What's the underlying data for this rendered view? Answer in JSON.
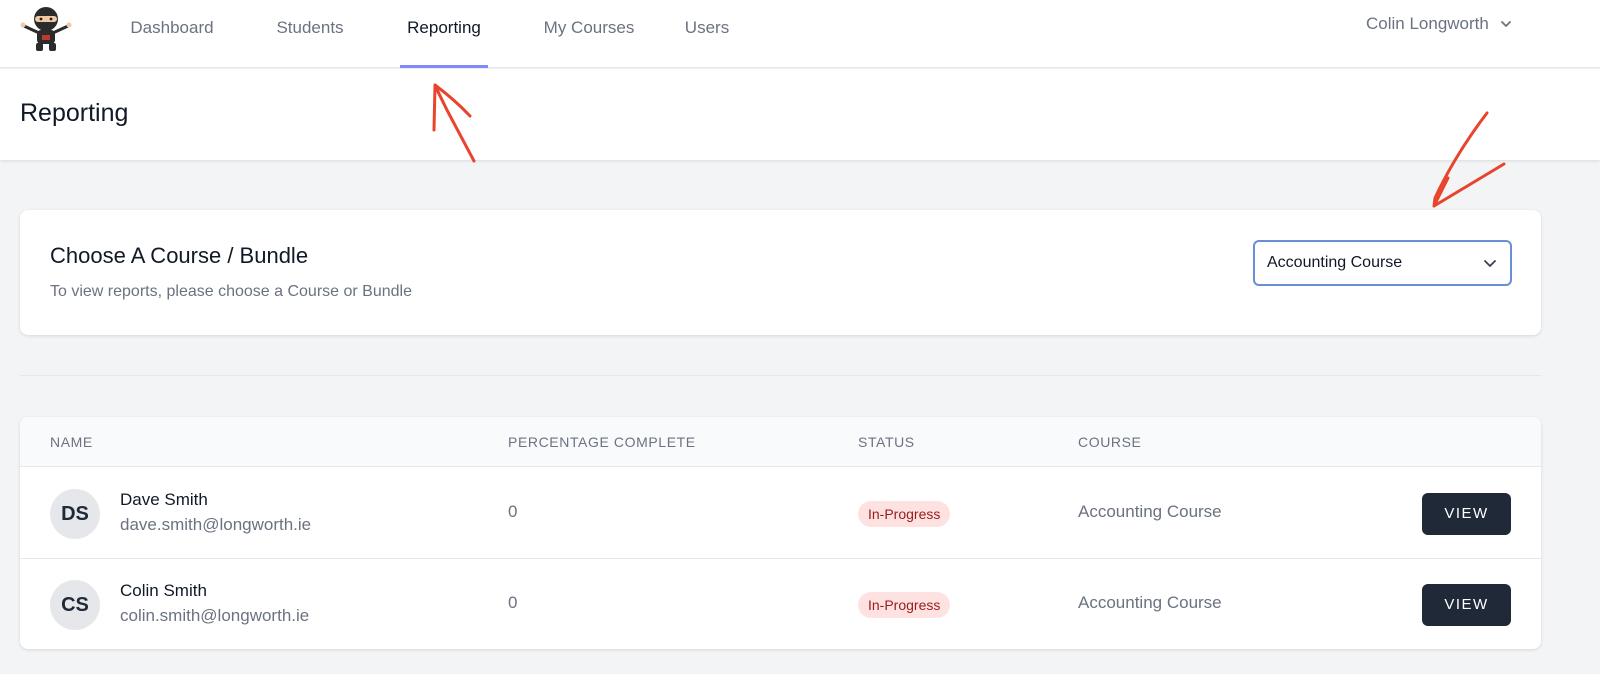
{
  "nav": {
    "items": [
      {
        "label": "Dashboard"
      },
      {
        "label": "Students"
      },
      {
        "label": "Reporting",
        "active": true
      },
      {
        "label": "My Courses"
      },
      {
        "label": "Users"
      }
    ],
    "user_name": "Colin Longworth"
  },
  "page": {
    "title": "Reporting"
  },
  "course_picker": {
    "title": "Choose A Course / Bundle",
    "subtitle": "To view reports, please choose a Course or Bundle",
    "selected": "Accounting Course"
  },
  "table": {
    "headers": [
      "NAME",
      "PERCENTAGE COMPLETE",
      "STATUS",
      "COURSE"
    ],
    "rows": [
      {
        "initials": "DS",
        "name": "Dave Smith",
        "email": "dave.smith@longworth.ie",
        "percent": "0",
        "status": "In-Progress",
        "course": "Accounting Course",
        "action": "VIEW"
      },
      {
        "initials": "CS",
        "name": "Colin Smith",
        "email": "colin.smith@longworth.ie",
        "percent": "0",
        "status": "In-Progress",
        "course": "Accounting Course",
        "action": "VIEW"
      }
    ]
  },
  "colors": {
    "accent": "#818cf8",
    "annotation": "#e8442e",
    "badge_bg": "#fee2e2",
    "badge_text": "#991b1b",
    "button_bg": "#1f2937"
  }
}
